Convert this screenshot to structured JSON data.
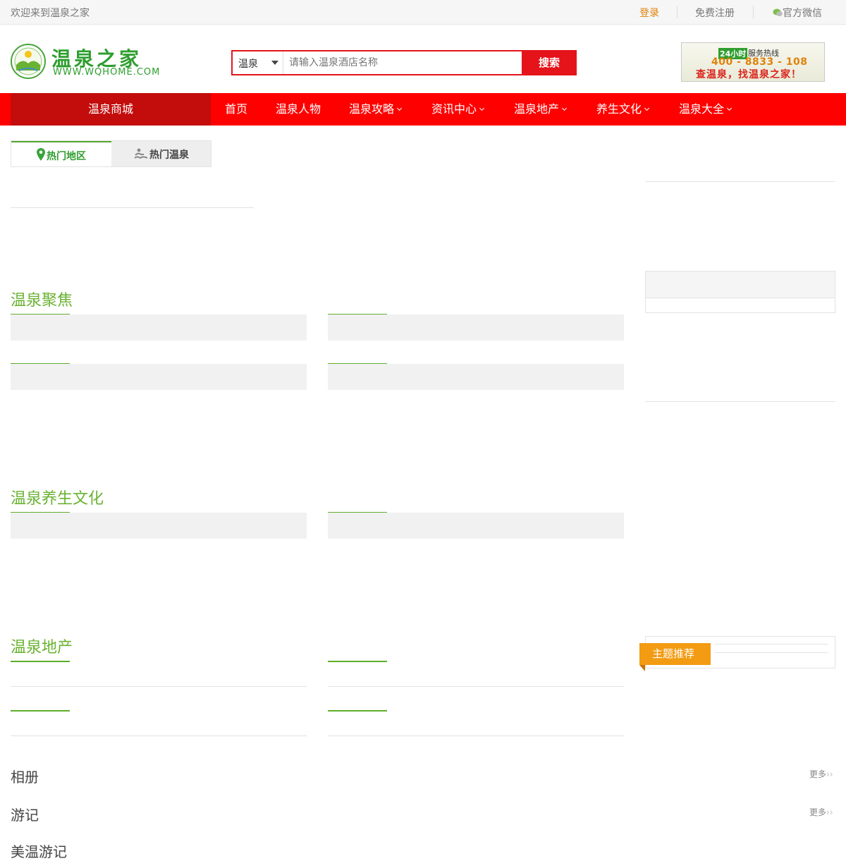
{
  "topbar": {
    "welcome": "欢迎来到温泉之家",
    "login": "登录",
    "register": "免费注册",
    "wechat": "官方微信"
  },
  "logo": {
    "name_cn": "温泉之家",
    "domain": "WWW.WQHOME.COM"
  },
  "search": {
    "category": "温泉",
    "placeholder": "请输入温泉酒店名称",
    "button": "搜索"
  },
  "hotline": {
    "badge": "24小时",
    "label": "服务热线",
    "number": "400 - 8833 - 108",
    "slogan": "查温泉，找温泉之家！"
  },
  "nav": {
    "mall": "温泉商城",
    "items": [
      "首页",
      "温泉人物",
      "温泉攻略",
      "资讯中心",
      "温泉地产",
      "养生文化",
      "温泉大全"
    ]
  },
  "tabs": {
    "hot_regions": "热门地区",
    "hot_springs": "热门温泉"
  },
  "sections": {
    "focus": "温泉聚焦",
    "wellness": "温泉养生文化",
    "realestate": "温泉地产",
    "album": "相册",
    "travel": "游记",
    "last": "美温游记"
  },
  "sidebar": {
    "theme": "主题推荐"
  },
  "more_label": "更多",
  "colors": {
    "primary_red": "#ff0000",
    "dark_red": "#c30c0c",
    "green": "#6ab232",
    "orange": "#f39b12",
    "login_orange": "#e0820a"
  }
}
